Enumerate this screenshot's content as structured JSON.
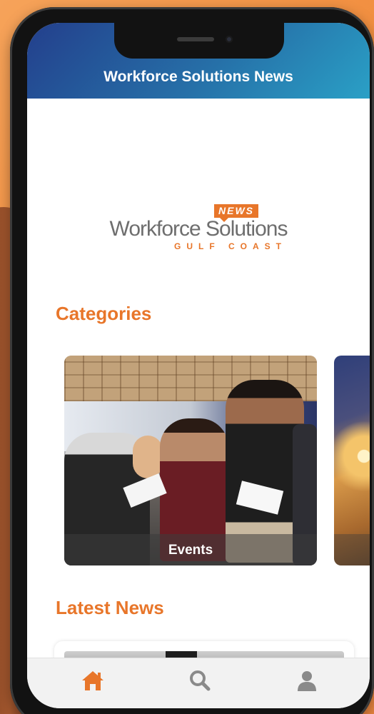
{
  "app": {
    "title": "Workforce Solutions News"
  },
  "logo": {
    "badge": "NEWS",
    "main": "Workforce Solutions",
    "sub": "GULF COAST"
  },
  "sections": {
    "categories_title": "Categories",
    "latest_news_title": "Latest News"
  },
  "categories": [
    {
      "label": "Events",
      "icon": "events-photo"
    },
    {
      "label": "",
      "icon": "welding-photo"
    }
  ],
  "tabbar": {
    "items": [
      {
        "label": "",
        "icon": "home-icon",
        "active": true
      },
      {
        "label": "",
        "icon": "search-icon",
        "active": false
      },
      {
        "label": "",
        "icon": "profile-icon",
        "active": false
      }
    ]
  },
  "colors": {
    "accent": "#e8762a",
    "header_start": "#233f8c",
    "header_end": "#2aa0c6",
    "tab_active": "#e8762a",
    "tab_inactive": "#8a8a8a"
  }
}
